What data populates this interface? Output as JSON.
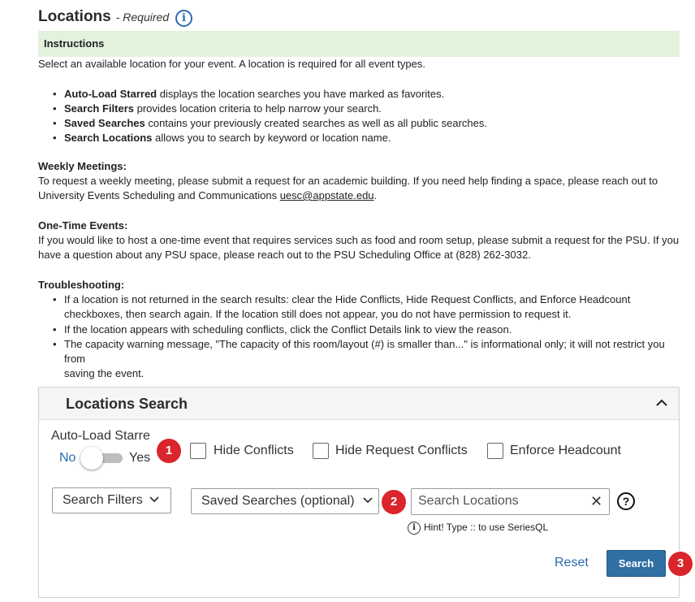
{
  "header": {
    "title": "Locations",
    "required_label": "- Required"
  },
  "instructions": {
    "heading": "Instructions",
    "intro": "Select an available location for your event. A location is required for all event types.",
    "bullets": [
      {
        "bold": "Auto-Load Starred",
        "rest": " displays the location searches you have marked as favorites."
      },
      {
        "bold": "Search Filters",
        "rest": " provides location criteria to help narrow your search."
      },
      {
        "bold": "Saved Searches",
        "rest": " contains your previously created searches as well as all public searches."
      },
      {
        "bold": "Search Locations",
        "rest": " allows you to search by keyword or location name."
      }
    ],
    "weekly_heading": "Weekly Meetings:",
    "weekly_line1": "To request a weekly meeting, please submit a request for an academic building. If you need help finding a space, please reach out to",
    "weekly_line2": "University Events Scheduling and Communications ",
    "weekly_email": "uesc@appstate.edu",
    "weekly_end": ".",
    "onetime_heading": "One-Time Events:",
    "onetime_line1": "If you would like to host a one-time event that requires services such as food and room setup, please submit a request for the PSU. If you",
    "onetime_line2": "have a question about any PSU space, please reach out to the PSU Scheduling Office at (828) 262-3032.",
    "trouble_heading": "Troubleshooting:",
    "trouble": [
      {
        "line1": "If a location is not returned in the search results: clear the Hide Conflicts, Hide Request Conflicts, and Enforce Headcount",
        "line2": "checkboxes, then search again. If the location still does not appear, you do not have permission to request it."
      },
      {
        "line1": "If the location appears with scheduling conflicts, click the Conflict Details link to view the reason.",
        "line2": ""
      },
      {
        "line1": "The capacity warning message, \"The capacity of this room/layout (#) is smaller than...\" is informational only; it will not restrict you from",
        "line2": "saving the event."
      }
    ]
  },
  "search_panel": {
    "title": "Locations Search",
    "auto_load_label": "Auto-Load Starre",
    "toggle_no": "No",
    "toggle_yes": "Yes",
    "toggle_on": false,
    "hide_conflicts": "Hide Conflicts",
    "hide_request_conflicts": "Hide Request Conflicts",
    "enforce_headcount": "Enforce Headcount",
    "search_filters": "Search Filters",
    "saved_searches": "Saved Searches (optional)",
    "search_placeholder": "Search Locations",
    "hint": "Hint! Type :: to use SeriesQL",
    "reset": "Reset",
    "search": "Search",
    "badges": [
      "1",
      "2",
      "3"
    ]
  },
  "colors": {
    "instructions_bg": "#e2f2dd",
    "primary": "#2f6fa3",
    "badge": "#d9252b",
    "link": "#2a6bb0"
  }
}
